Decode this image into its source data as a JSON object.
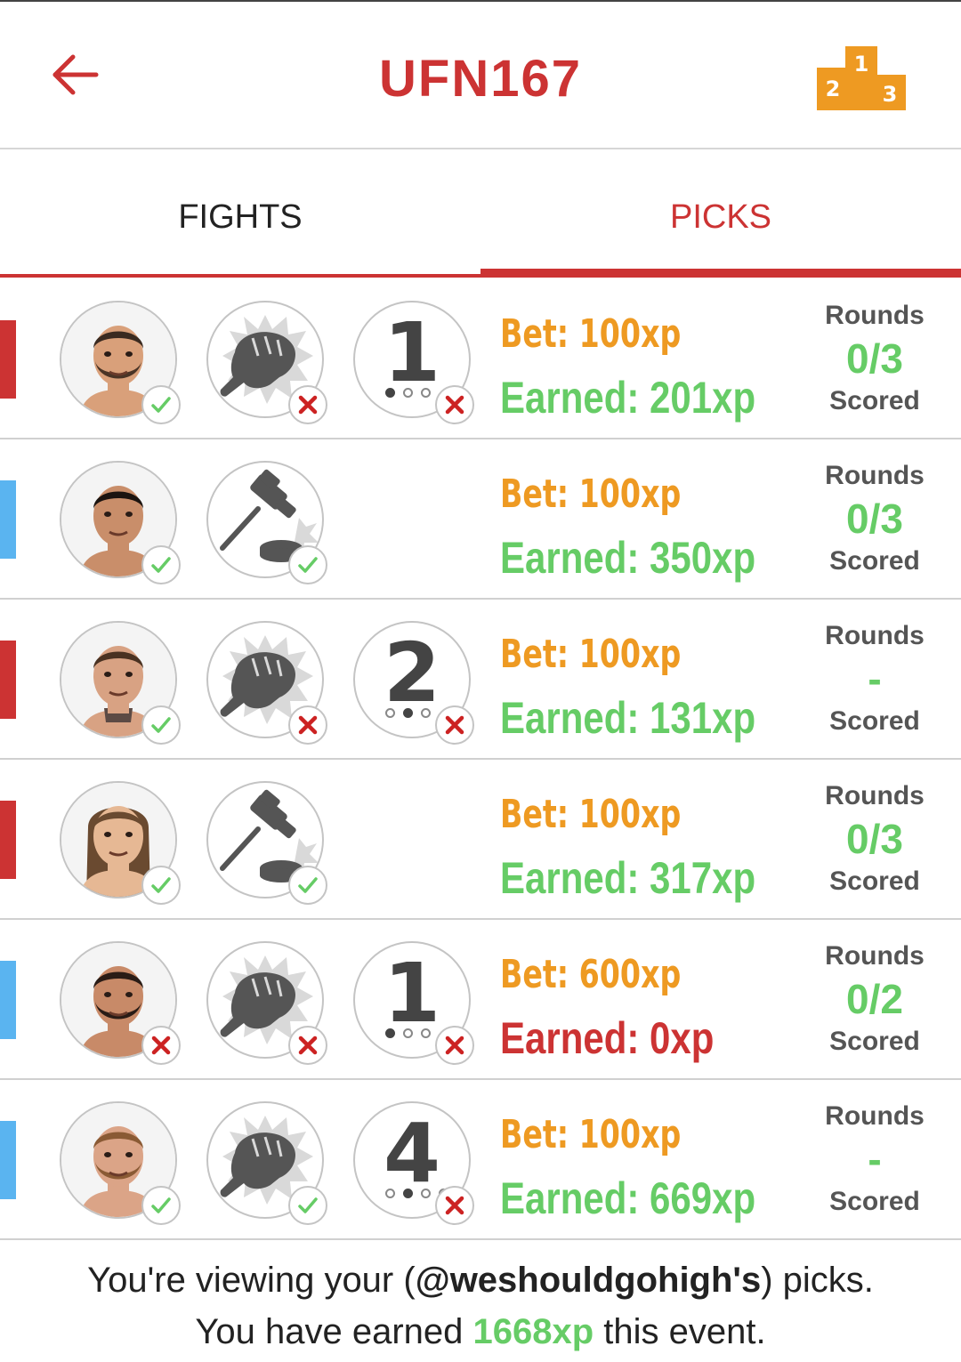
{
  "header": {
    "title": "UFN167",
    "podium_labels": [
      "1",
      "2",
      "3"
    ],
    "accent_color": "#cc3333",
    "podium_color": "#ee9a22"
  },
  "tabs": {
    "fights_label": "FIGHTS",
    "picks_label": "PICKS",
    "active": "PICKS"
  },
  "colors": {
    "red_corner": "#cc3333",
    "blue_corner": "#5ab4f0",
    "bet": "#ee9a22",
    "earned_positive": "#66cc66",
    "earned_zero": "#cc3333"
  },
  "picks": [
    {
      "corner": "red",
      "fighter_result": "check",
      "method_icon": "fist-icon",
      "method_result": "cross",
      "round": "1",
      "round_dots": [
        1,
        0,
        0
      ],
      "round_result": "cross",
      "bet": "Bet: 100xp",
      "earned": "Earned: 201xp",
      "rounds_label": "Rounds",
      "rounds_value": "0/3",
      "rounds_scored": "Scored"
    },
    {
      "corner": "blue",
      "fighter_result": "check",
      "method_icon": "gavel-icon",
      "method_result": "check",
      "round": "",
      "round_dots": [],
      "round_result": "",
      "bet": "Bet: 100xp",
      "earned": "Earned: 350xp",
      "rounds_label": "Rounds",
      "rounds_value": "0/3",
      "rounds_scored": "Scored"
    },
    {
      "corner": "red",
      "fighter_result": "check",
      "method_icon": "fist-icon",
      "method_result": "cross",
      "round": "2",
      "round_dots": [
        0,
        1,
        0
      ],
      "round_result": "cross",
      "bet": "Bet: 100xp",
      "earned": "Earned: 131xp",
      "rounds_label": "Rounds",
      "rounds_value": "-",
      "rounds_scored": "Scored"
    },
    {
      "corner": "red",
      "fighter_result": "check",
      "method_icon": "gavel-icon",
      "method_result": "check",
      "round": "",
      "round_dots": [],
      "round_result": "",
      "bet": "Bet: 100xp",
      "earned": "Earned: 317xp",
      "rounds_label": "Rounds",
      "rounds_value": "0/3",
      "rounds_scored": "Scored"
    },
    {
      "corner": "blue",
      "fighter_result": "cross",
      "method_icon": "fist-icon",
      "method_result": "cross",
      "round": "1",
      "round_dots": [
        1,
        0,
        0
      ],
      "round_result": "cross",
      "bet": "Bet: 600xp",
      "earned": "Earned: 0xp",
      "earned_zero": true,
      "rounds_label": "Rounds",
      "rounds_value": "0/2",
      "rounds_scored": "Scored"
    },
    {
      "corner": "blue",
      "fighter_result": "check",
      "method_icon": "fist-icon",
      "method_result": "check",
      "round": "4",
      "round_dots": [
        0,
        1,
        0,
        0
      ],
      "round_result": "cross",
      "bet": "Bet: 100xp",
      "earned": "Earned: 669xp",
      "rounds_label": "Rounds",
      "rounds_value": "-",
      "rounds_scored": "Scored"
    }
  ],
  "footer": {
    "line1_prefix": "You're viewing your (",
    "username": "@weshouldgohigh's",
    "line1_suffix": ") picks.",
    "line2_prefix": "You have earned ",
    "total_xp": "1668xp",
    "line2_suffix": " this event."
  }
}
